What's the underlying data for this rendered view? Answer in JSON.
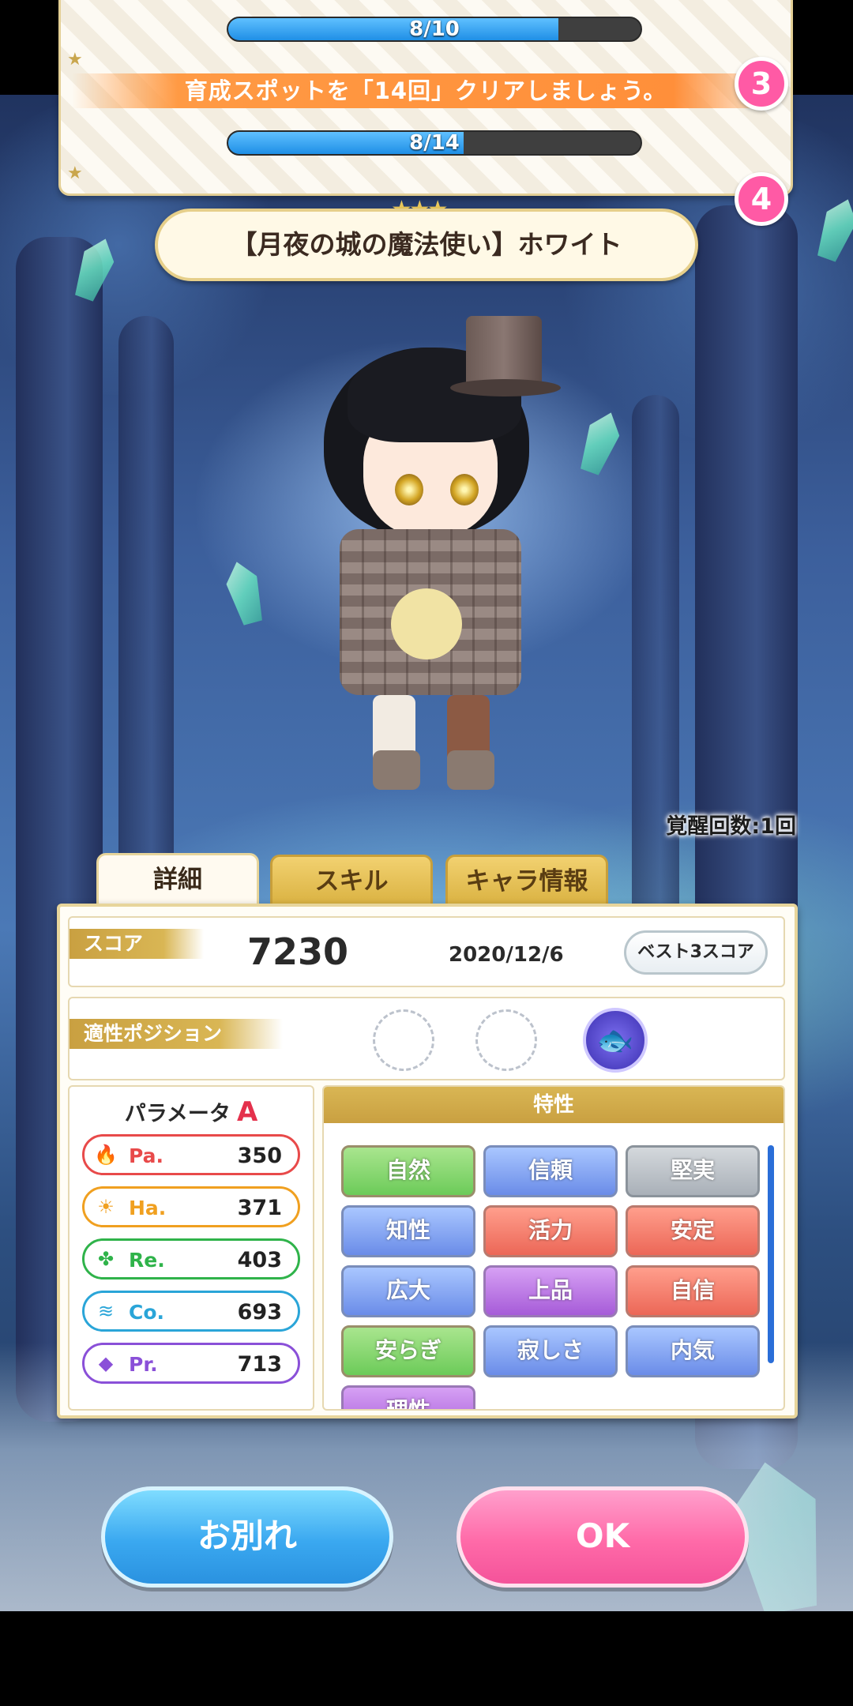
{
  "missions": [
    {
      "title": "",
      "progress_text": "8/10",
      "progress": 0.8
    },
    {
      "title": "育成スポットを「14回」クリアしましょう。",
      "progress_text": "8/14",
      "progress": 0.5714
    }
  ],
  "badges": [
    "3",
    "4"
  ],
  "character": {
    "name": "【月夜の城の魔法使い】ホワイト",
    "awakening_text": "覚醒回数:1回"
  },
  "tabs": [
    {
      "label": "詳細",
      "active": true
    },
    {
      "label": "スキル",
      "active": false
    },
    {
      "label": "キャラ情報",
      "active": false
    }
  ],
  "score": {
    "label": "スコア",
    "value": "7230",
    "date": "2020/12/6",
    "best_button": "ベスト3スコア"
  },
  "position": {
    "label": "適性ポジション"
  },
  "parameters": {
    "title": "パラメータ",
    "rank": "A",
    "stats": [
      {
        "name": "Pa.",
        "value": "350",
        "color": "#e84a4a",
        "icon": "flame-icon"
      },
      {
        "name": "Ha.",
        "value": "371",
        "color": "#f0a020",
        "icon": "sun-icon"
      },
      {
        "name": "Re.",
        "value": "403",
        "color": "#2fb34a",
        "icon": "clover-icon"
      },
      {
        "name": "Co.",
        "value": "693",
        "color": "#2aa5d8",
        "icon": "wave-icon"
      },
      {
        "name": "Pr.",
        "value": "713",
        "color": "#8a50d8",
        "icon": "diamond-icon"
      }
    ]
  },
  "traits": {
    "title": "特性",
    "items": [
      {
        "label": "自然",
        "color": "green"
      },
      {
        "label": "信頼",
        "color": "blue"
      },
      {
        "label": "堅実",
        "color": "gray"
      },
      {
        "label": "知性",
        "color": "blue"
      },
      {
        "label": "活力",
        "color": "red"
      },
      {
        "label": "安定",
        "color": "red"
      },
      {
        "label": "広大",
        "color": "blue"
      },
      {
        "label": "上品",
        "color": "purple"
      },
      {
        "label": "自信",
        "color": "red"
      },
      {
        "label": "安らぎ",
        "color": "green"
      },
      {
        "label": "寂しさ",
        "color": "blue"
      },
      {
        "label": "内気",
        "color": "blue"
      },
      {
        "label": "理性",
        "color": "purple"
      }
    ]
  },
  "buttons": {
    "farewell": "お別れ",
    "ok": "OK"
  }
}
